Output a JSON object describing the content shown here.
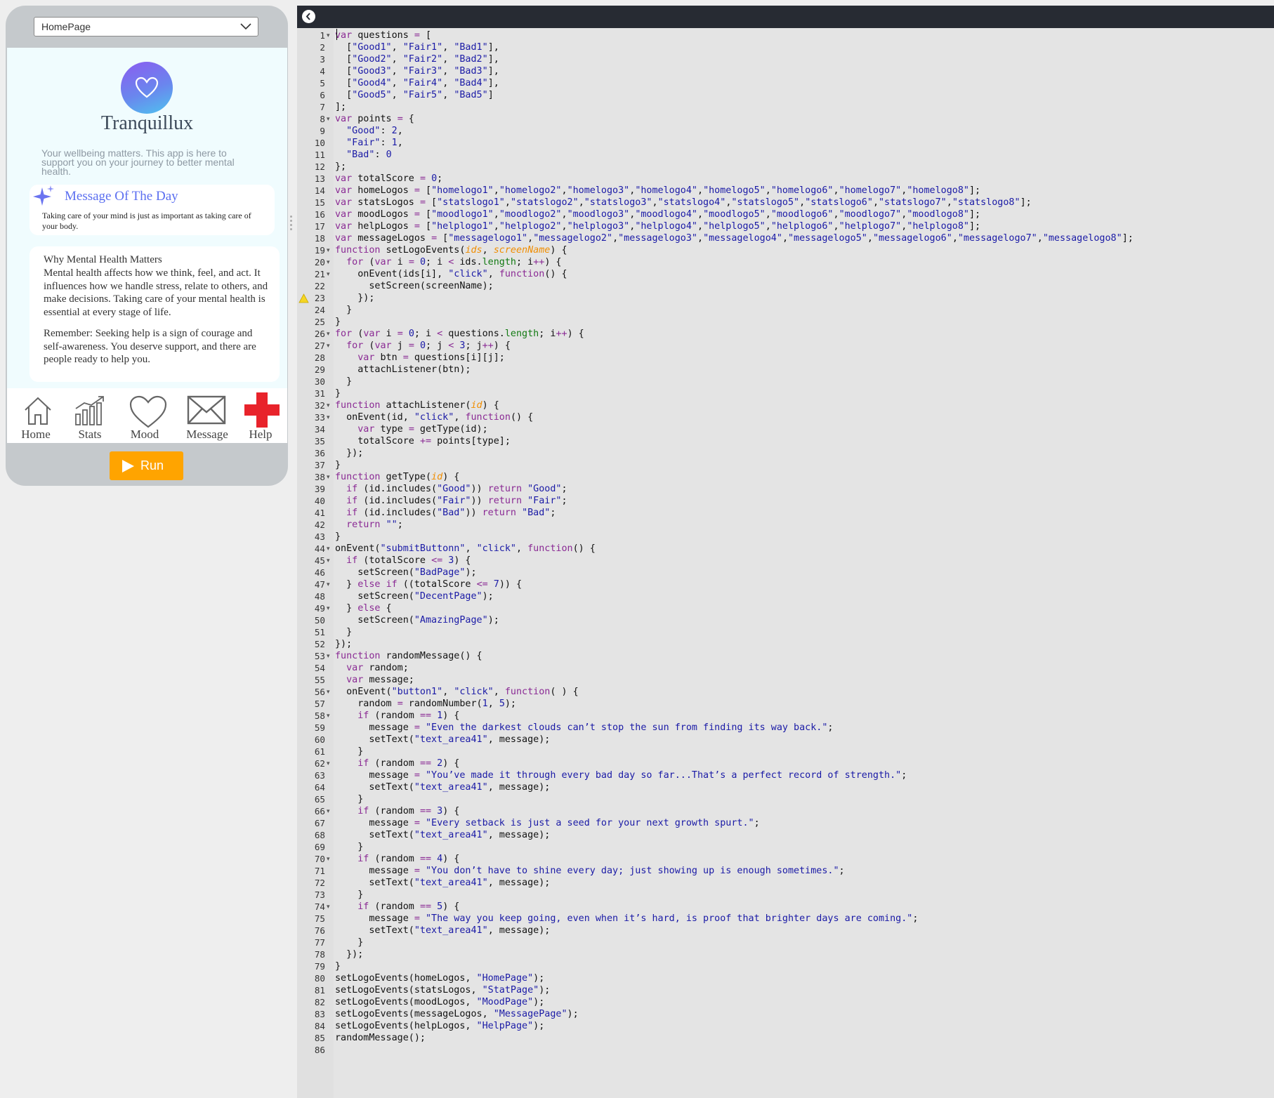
{
  "phone": {
    "screen_dropdown": "HomePage",
    "app_title": "Tranquillux",
    "app_subtitle": "Your wellbeing matters. This app is here to support you on your journey to better mental health.",
    "motd_title": "Message Of The Day",
    "motd_text": "Taking care of your mind is just as important as taking care of your body.",
    "info_title": "Why Mental Health Matters",
    "info_body": "Mental health affects how we think, feel, and act. It influences how we handle stress, relate to others, and make decisions. Taking care of your mental health is essential at every stage of life.",
    "info_body2": "Remember: Seeking help is a sign of courage and self-awareness. You deserve support, and there are people ready to help you.",
    "nav": [
      {
        "label": "Home",
        "icon": "home-icon"
      },
      {
        "label": "Stats",
        "icon": "stats-icon"
      },
      {
        "label": "Mood",
        "icon": "heart-icon"
      },
      {
        "label": "Message",
        "icon": "envelope-icon"
      },
      {
        "label": "Help",
        "icon": "red-cross-icon"
      }
    ],
    "run_label": "Run",
    "colors": {
      "run": "#ffa400",
      "accent": "#5b6ff0",
      "help_cross": "#e8232b"
    }
  },
  "editor": {
    "warning_line": 23,
    "fold_lines": [
      1,
      8,
      19,
      20,
      21,
      26,
      27,
      32,
      33,
      38,
      44,
      45,
      47,
      49,
      53,
      56,
      58,
      62,
      66,
      70,
      74
    ],
    "lines": [
      "var questions = [",
      "  [\"Good1\", \"Fair1\", \"Bad1\"],",
      "  [\"Good2\", \"Fair2\", \"Bad2\"],",
      "  [\"Good3\", \"Fair3\", \"Bad3\"],",
      "  [\"Good4\", \"Fair4\", \"Bad4\"],",
      "  [\"Good5\", \"Fair5\", \"Bad5\"]",
      "];",
      "var points = {",
      "  \"Good\": 2,",
      "  \"Fair\": 1,",
      "  \"Bad\": 0",
      "};",
      "var totalScore = 0;",
      "var homeLogos = [\"homelogo1\",\"homelogo2\",\"homelogo3\",\"homelogo4\",\"homelogo5\",\"homelogo6\",\"homelogo7\",\"homelogo8\"];",
      "var statsLogos = [\"statslogo1\",\"statslogo2\",\"statslogo3\",\"statslogo4\",\"statslogo5\",\"statslogo6\",\"statslogo7\",\"statslogo8\"];",
      "var moodLogos = [\"moodlogo1\",\"moodlogo2\",\"moodlogo3\",\"moodlogo4\",\"moodlogo5\",\"moodlogo6\",\"moodlogo7\",\"moodlogo8\"];",
      "var helpLogos = [\"helplogo1\",\"helplogo2\",\"helplogo3\",\"helplogo4\",\"helplogo5\",\"helplogo6\",\"helplogo7\",\"helplogo8\"];",
      "var messageLogos = [\"messagelogo1\",\"messagelogo2\",\"messagelogo3\",\"messagelogo4\",\"messagelogo5\",\"messagelogo6\",\"messagelogo7\",\"messagelogo8\"];",
      "function setLogoEvents(ids, screenName) {",
      "  for (var i = 0; i < ids.length; i++) {",
      "    onEvent(ids[i], \"click\", function() {",
      "      setScreen(screenName);",
      "    });",
      "  }",
      "}",
      "for (var i = 0; i < questions.length; i++) {",
      "  for (var j = 0; j < 3; j++) {",
      "    var btn = questions[i][j];",
      "    attachListener(btn);",
      "  }",
      "}",
      "function attachListener(id) {",
      "  onEvent(id, \"click\", function() {",
      "    var type = getType(id);",
      "    totalScore += points[type];",
      "  });",
      "}",
      "function getType(id) {",
      "  if (id.includes(\"Good\")) return \"Good\";",
      "  if (id.includes(\"Fair\")) return \"Fair\";",
      "  if (id.includes(\"Bad\")) return \"Bad\";",
      "  return \"\";",
      "}",
      "onEvent(\"submitButtonn\", \"click\", function() {",
      "  if (totalScore <= 3) {",
      "    setScreen(\"BadPage\");",
      "  } else if ((totalScore <= 7)) {",
      "    setScreen(\"DecentPage\");",
      "  } else {",
      "    setScreen(\"AmazingPage\");",
      "  }",
      "});",
      "function randomMessage() {",
      "  var random;",
      "  var message;",
      "  onEvent(\"button1\", \"click\", function( ) {",
      "    random = randomNumber(1, 5);",
      "    if (random == 1) {",
      "      message = \"Even the darkest clouds can’t stop the sun from finding its way back.\";",
      "      setText(\"text_area41\", message);",
      "    }",
      "    if (random == 2) {",
      "      message = \"You’ve made it through every bad day so far...That’s a perfect record of strength.\";",
      "      setText(\"text_area41\", message);",
      "    }",
      "    if (random == 3) {",
      "      message = \"Every setback is just a seed for your next growth spurt.\";",
      "      setText(\"text_area41\", message);",
      "    }",
      "    if (random == 4) {",
      "      message = \"You don’t have to shine every day; just showing up is enough sometimes.\";",
      "      setText(\"text_area41\", message);",
      "    }",
      "    if (random == 5) {",
      "      message = \"The way you keep going, even when it’s hard, is proof that brighter days are coming.\";",
      "      setText(\"text_area41\", message);",
      "    }",
      "  });",
      "}",
      "setLogoEvents(homeLogos, \"HomePage\");",
      "setLogoEvents(statsLogos, \"StatPage\");",
      "setLogoEvents(moodLogos, \"MoodPage\");",
      "setLogoEvents(messageLogos, \"MessagePage\");",
      "setLogoEvents(helpLogos, \"HelpPage\");",
      "randomMessage();",
      ""
    ]
  }
}
